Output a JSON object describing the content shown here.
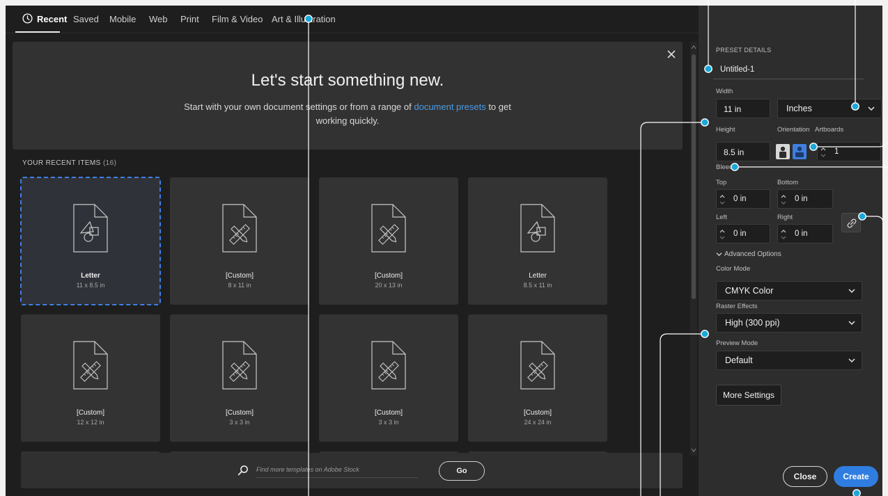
{
  "tabs": [
    "Recent",
    "Saved",
    "Mobile",
    "Web",
    "Print",
    "Film & Video",
    "Art & Illustration"
  ],
  "hero": {
    "title": "Let's start something new.",
    "subtitle_before": "Start with your own document settings or from a range of ",
    "subtitle_link": "document presets",
    "subtitle_after": " to get working quickly."
  },
  "recent": {
    "label": "YOUR RECENT ITEMS",
    "count": "(16)",
    "items": [
      {
        "name": "Letter",
        "size": "11 x 8.5 in",
        "icon": "shape-document-icon"
      },
      {
        "name": "[Custom]",
        "size": "8 x 11 in",
        "icon": "custom-document-icon"
      },
      {
        "name": "[Custom]",
        "size": "20 x 13 in",
        "icon": "custom-document-icon"
      },
      {
        "name": "Letter",
        "size": "8.5 x 11 in",
        "icon": "shape-document-icon"
      },
      {
        "name": "[Custom]",
        "size": "12 x 12 in",
        "icon": "custom-document-icon"
      },
      {
        "name": "[Custom]",
        "size": "3 x 3 in",
        "icon": "custom-document-icon"
      },
      {
        "name": "[Custom]",
        "size": "3 x 3 in",
        "icon": "custom-document-icon"
      },
      {
        "name": "[Custom]",
        "size": "24 x 24 in",
        "icon": "custom-document-icon"
      }
    ]
  },
  "search": {
    "placeholder": "Find more templates on Adobe Stock",
    "go_label": "Go"
  },
  "panel": {
    "header": "PRESET DETAILS",
    "preset_name": "Untitled-1",
    "width_label": "Width",
    "width_value": "11 in",
    "units_value": "Inches",
    "height_label": "Height",
    "height_value": "8.5 in",
    "orientation_label": "Orientation",
    "artboards_label": "Artboards",
    "artboards_value": "1",
    "bleed_label": "Bleed",
    "top_label": "Top",
    "top_value": "0 in",
    "bottom_label": "Bottom",
    "bottom_value": "0 in",
    "left_label": "Left",
    "left_value": "0 in",
    "right_label": "Right",
    "right_value": "0 in",
    "advanced_label": "Advanced Options",
    "color_mode_label": "Color Mode",
    "color_mode_value": "CMYK Color",
    "raster_label": "Raster Effects",
    "raster_value": "High (300 ppi)",
    "preview_label": "Preview Mode",
    "preview_value": "Default",
    "more_settings_label": "More Settings",
    "close_label": "Close",
    "create_label": "Create"
  },
  "colors": {
    "accent": "#2f7de1",
    "callout": "#1ba8d8",
    "background": "#1e1e1e",
    "panel": "#2d2d2d"
  }
}
